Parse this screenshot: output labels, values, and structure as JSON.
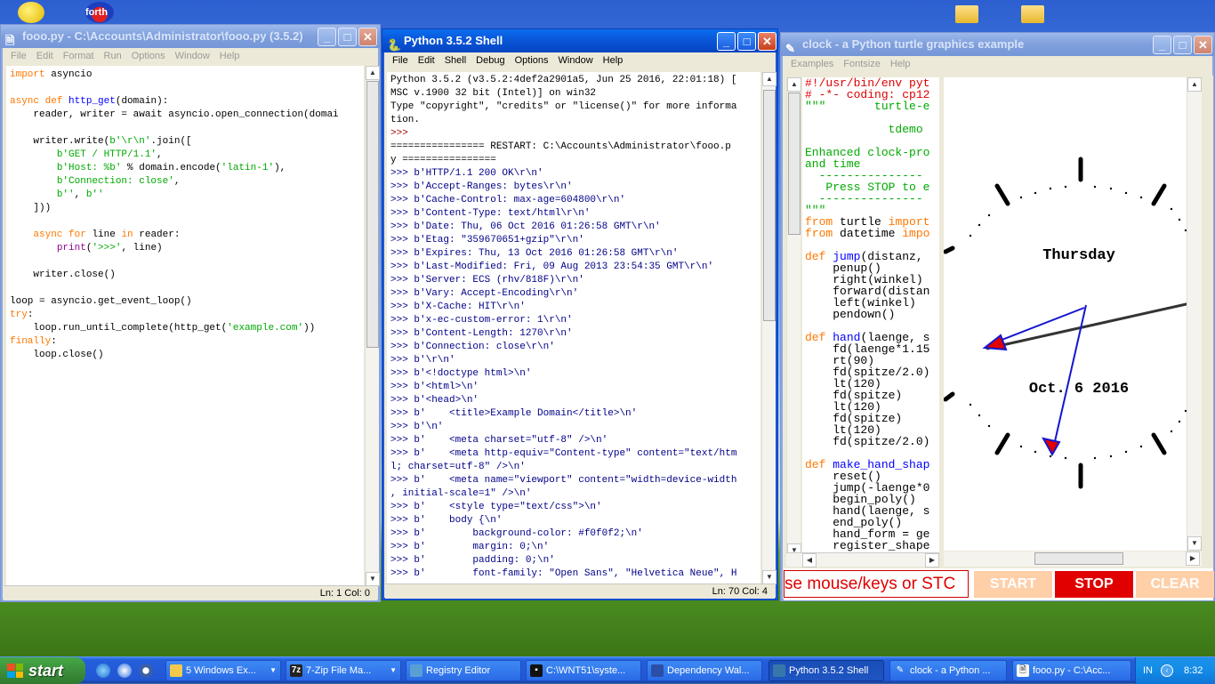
{
  "desktop": {
    "icons": [
      {
        "name": "smiley-icon"
      },
      {
        "name": "forth-icon",
        "label": "forth"
      },
      {
        "name": "folder-icon"
      },
      {
        "name": "folder-icon-2"
      }
    ]
  },
  "editor": {
    "title": "fooo.py - C:\\Accounts\\Administrator\\fooo.py (3.5.2)",
    "menu": [
      "File",
      "Edit",
      "Format",
      "Run",
      "Options",
      "Window",
      "Help"
    ],
    "status": "Ln: 1   Col: 0"
  },
  "shell": {
    "title": "Python 3.5.2 Shell",
    "menu": [
      "File",
      "Edit",
      "Shell",
      "Debug",
      "Options",
      "Window",
      "Help"
    ],
    "status": "Ln: 70   Col: 4"
  },
  "turtle": {
    "title": "clock - a Python turtle graphics example",
    "menu": [
      "Examples",
      "Fontsize",
      "Help"
    ],
    "weekday": "Thursday",
    "date": "Oct. 6 2016",
    "message": "se mouse/keys or STC",
    "buttons": {
      "start": "START",
      "stop": "STOP",
      "clear": "CLEAR"
    }
  },
  "taskbar": {
    "start": "start",
    "items": [
      "5 Windows Ex...",
      "7-Zip File Ma...",
      "Registry Editor",
      "C:\\WNT51\\syste...",
      "Dependency Wal...",
      "Python 3.5.2 Shell",
      "clock - a Python ...",
      "fooo.py - C:\\Acc..."
    ],
    "lang": "IN",
    "clock": "8:32"
  },
  "colors": {
    "titlebar": "#0a56d8",
    "stop": "#e00000",
    "start_disabled": "#ffcfa8",
    "keyword": "#ff7700",
    "string": "#00aa00",
    "builtin": "#900090",
    "output": "#000088"
  }
}
